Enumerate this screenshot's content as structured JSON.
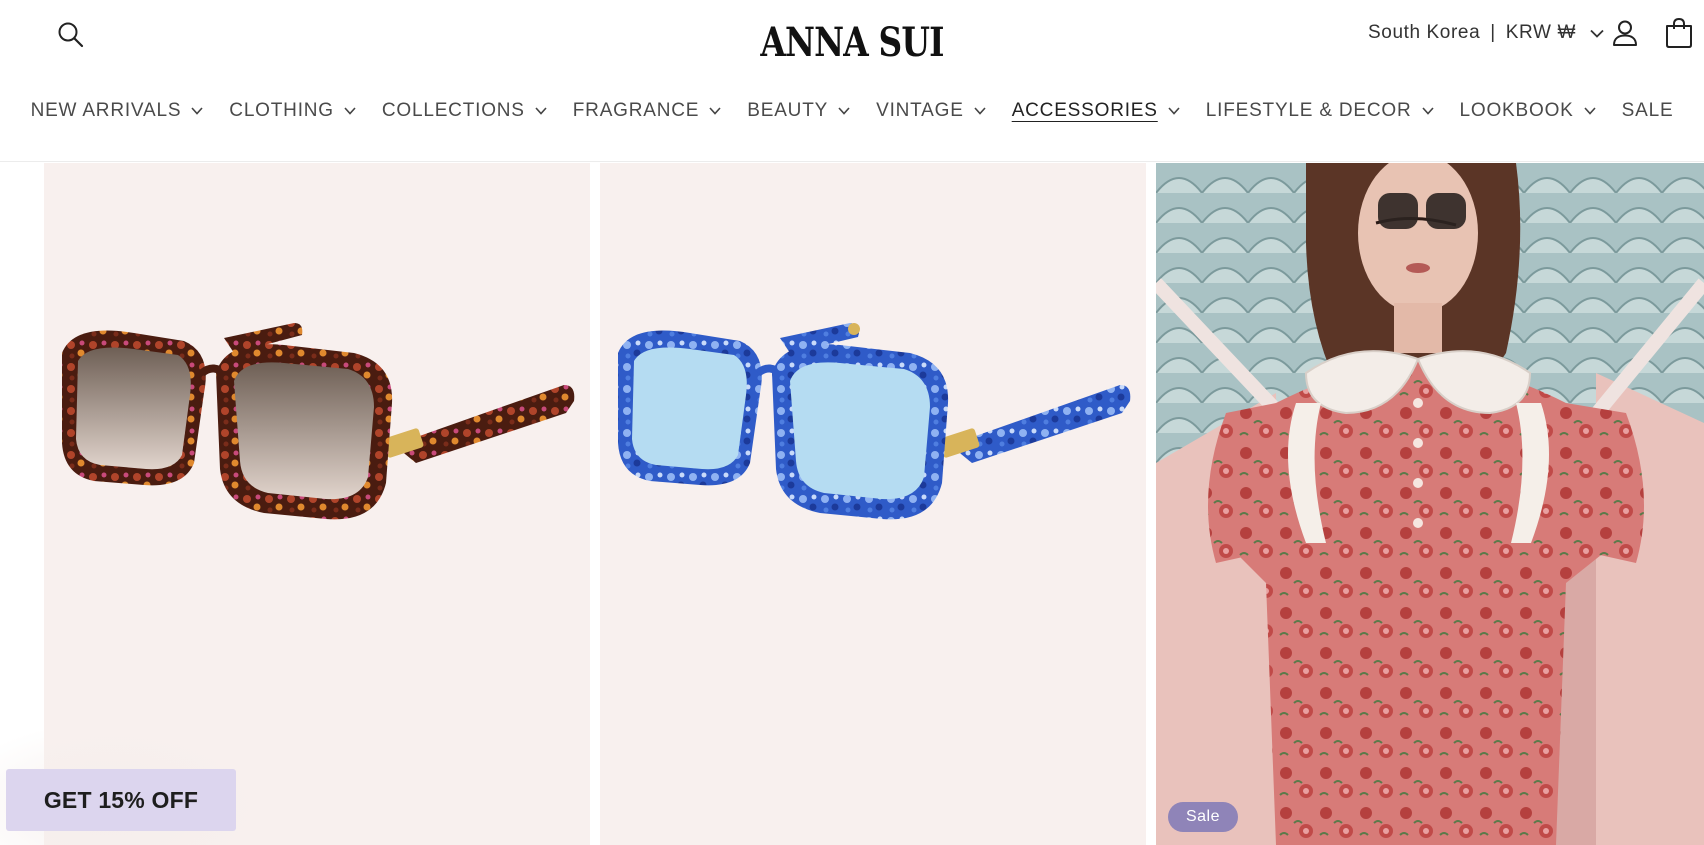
{
  "header": {
    "logo": "ANNA SUI",
    "locale": {
      "country": "South Korea",
      "separator": "|",
      "currency": "KRW ₩"
    },
    "icons": {
      "search": "search-icon",
      "account": "account-icon",
      "cart": "cart-icon"
    }
  },
  "nav": {
    "items": [
      {
        "label": "NEW ARRIVALS",
        "has_dropdown": true
      },
      {
        "label": "CLOTHING",
        "has_dropdown": true
      },
      {
        "label": "COLLECTIONS",
        "has_dropdown": true
      },
      {
        "label": "FRAGRANCE",
        "has_dropdown": true
      },
      {
        "label": "BEAUTY",
        "has_dropdown": true
      },
      {
        "label": "VINTAGE",
        "has_dropdown": true
      },
      {
        "label": "ACCESSORIES",
        "has_dropdown": true,
        "active": true
      },
      {
        "label": "LIFESTYLE & DECOR",
        "has_dropdown": true
      },
      {
        "label": "LOOKBOOK",
        "has_dropdown": true
      },
      {
        "label": "SALE",
        "has_dropdown": false
      }
    ]
  },
  "products": [
    {
      "image": "tortoiseshell-square-sunglasses",
      "frame_color": "#5a2516",
      "lens_color": "#8a7a6e"
    },
    {
      "image": "blue-marble-square-sunglasses",
      "frame_color": "#2f5bc8",
      "lens_color": "#b5dcf2"
    },
    {
      "image": "model-in-floral-dress-with-ruffle-collar",
      "badge": "Sale"
    }
  ],
  "promo": {
    "label": "GET 15% OFF"
  },
  "colors": {
    "accent": "#8f84b8",
    "promo_bg": "#dcd5ee",
    "card_bg": "#f8f0ee"
  }
}
